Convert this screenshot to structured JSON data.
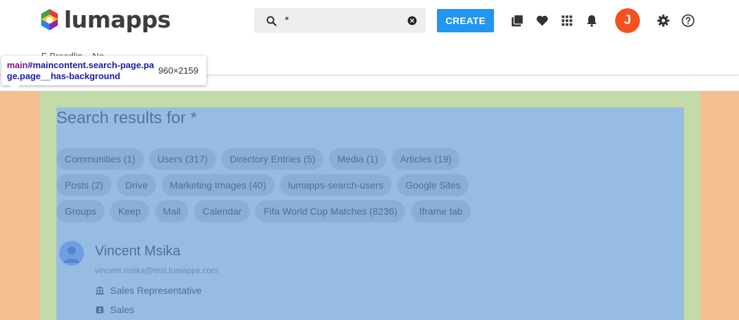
{
  "header": {
    "logo_text": "lumapps",
    "search": {
      "value": "*",
      "placeholder": ""
    },
    "create_label": "CREATE",
    "avatar_initial": "J",
    "breadcrumb_hint": "Ε     Breadlin...     No..."
  },
  "inspector": {
    "tag": "main",
    "selector": "#maincontent.search-page.page.page__has-background",
    "dimensions": "960×2159"
  },
  "search_results": {
    "title": "Search results for *",
    "chips_row1": [
      "Communities (1)",
      "Users (317)",
      "Directory Entries (5)",
      "Media (1)",
      "Articles (19)"
    ],
    "chips_row2": [
      "Posts (2)",
      "Drive",
      "Marketing Images (40)",
      "lumapps-search-users",
      "Google Sites"
    ],
    "chips_row3": [
      "Groups",
      "Keep",
      "Mail",
      "Calendar",
      "Fifa World Cup Matches (8236)",
      "Iframe tab"
    ],
    "result": {
      "name": "Vincent Msika",
      "email": "vincent.msika@test.lumapps.com",
      "job_title": "Sales Representative",
      "department": "Sales"
    }
  },
  "colors": {
    "brand_blue": "#2196f3",
    "avatar_orange": "#f4511e",
    "overlay_margin": "#f3bf8f",
    "overlay_padding": "#c3dba8",
    "overlay_content": "#97bce4"
  },
  "icons": [
    "search-icon",
    "clear-icon",
    "content-library-icon",
    "heart-icon",
    "apps-grid-icon",
    "bell-icon",
    "gear-icon",
    "help-icon",
    "bank-icon",
    "badge-icon"
  ]
}
